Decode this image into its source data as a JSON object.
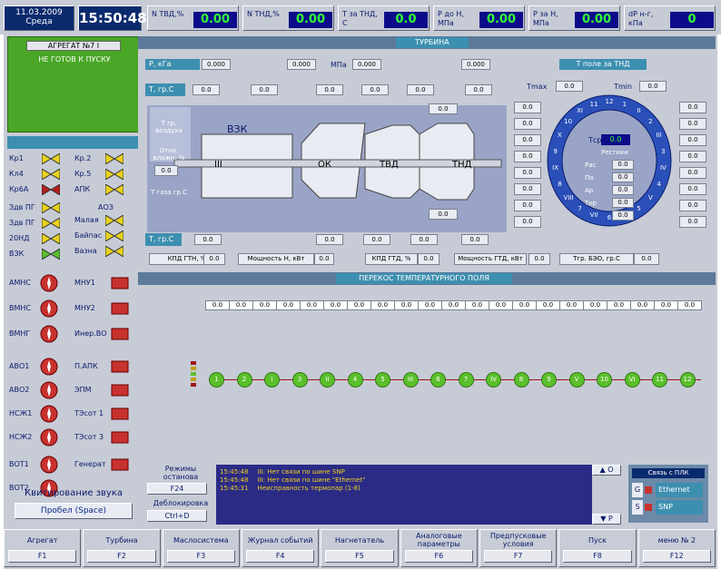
{
  "topbar": {
    "date": "11.03.2009",
    "day": "Среда",
    "time": "15:50:48",
    "params": [
      {
        "label": "N ТВД,%",
        "value": "0.00"
      },
      {
        "label": "N ТНД,%",
        "value": "0.00"
      },
      {
        "label": "T за ТНД, С",
        "value": "0.0"
      },
      {
        "label": "P до Н, МПа",
        "value": "0.00"
      },
      {
        "label": "P за Н, МПа",
        "value": "0.00"
      },
      {
        "label": "dP н-г, кПа",
        "value": "0"
      }
    ]
  },
  "status": {
    "aggregate": "АГРЕГАТ №7 I",
    "state": "НЕ ГОТОВ К ПУСКУ"
  },
  "valves_left": [
    {
      "label": "Кр1",
      "state": "yellow"
    },
    {
      "label": "Кл4",
      "state": "yellow"
    },
    {
      "label": "Кр6А",
      "state": "red"
    },
    {
      "label": "Здв ПГ",
      "state": "yellow"
    },
    {
      "label": "Здв ПГ",
      "state": "yellow"
    },
    {
      "label": "20НД",
      "state": "yellow"
    },
    {
      "label": "ВЗК",
      "state": "green"
    }
  ],
  "valves_right": [
    {
      "label": "Кр.2",
      "state": "yellow"
    },
    {
      "label": "Кр.5",
      "state": "yellow"
    },
    {
      "label": "АПК",
      "state": "yellow"
    },
    {
      "label": "Малая",
      "state": "yellow"
    },
    {
      "label": "Байпас",
      "state": "yellow"
    },
    {
      "label": "Вазна",
      "state": "yellow"
    }
  ],
  "aso_label": "АОЗ",
  "pumps_left": [
    "АМНС",
    "ВМНС",
    "ВМНГ",
    "АВО1",
    "АВО2",
    "НСЖ1",
    "НСЖ2",
    "ВОТ1",
    "ВОТ2"
  ],
  "pumps_right": [
    "МНУ1",
    "МНУ2",
    "Инер.ВО",
    "П.АПК",
    "ЭПМ",
    "ТЭсот 1",
    "ТЭсот 3",
    "Генерат"
  ],
  "sound": {
    "title": "Квитирование звука",
    "button": "Пробел (Space)"
  },
  "turbine": {
    "title": "ТУРБИНА",
    "p_label": "P, кГа",
    "p_values": [
      "0.000",
      "0.000",
      "0.000",
      "0.000"
    ],
    "p_unit": "МПа",
    "t_label": "T, гр.С",
    "t_values": [
      "0.0",
      "0.0",
      "0.0",
      "0.0",
      "0.0",
      "0.0"
    ],
    "t_lower_label": "T, гр.С",
    "t_lower_values": [
      "0.0",
      "0.0",
      "0.0",
      "0.0",
      "0.0"
    ],
    "t_air": "T гр. воздуха",
    "rel_hum": "Отно. влажн. %",
    "rel_val": "0.0",
    "t_fuel": "T газа гр.С",
    "vzk": "ВЗК",
    "blocks": [
      "III",
      "ОК",
      "ТВД",
      "ТНД"
    ],
    "mid_values": [
      "0.0",
      "0.0"
    ],
    "kpd_gtn": "КПД ГТН, %",
    "kpd_gtn_val": "0.0",
    "power_n": "Мощность Н, кВт",
    "power_n_val": "0.0",
    "kpd_gtd": "КПД ГТД, %",
    "kpd_gtd_val": "0.0",
    "power_gtd": "Мощность ГТД, кВт",
    "power_gtd_val": "0.0",
    "t_beo": "Тгр. БЭО, гр.С",
    "t_beo_val": "0.0"
  },
  "tnd_field": {
    "title": "T поле за ТНД",
    "tmax_label": "Tmax",
    "tmax": "0.0",
    "tmin_label": "Tmin",
    "tmin": "0.0",
    "left_values": [
      "0.0",
      "0.0",
      "0.0",
      "0.0",
      "0.0",
      "0.0",
      "0.0",
      "0.0"
    ],
    "right_values": [
      "0.0",
      "0.0",
      "0.0",
      "0.0",
      "0.0",
      "0.0",
      "0.0",
      "0.0"
    ],
    "center_label": "Тср",
    "center_val": "0.0",
    "sub_label": "Рестики",
    "center_small": [
      "0.0",
      "0.0",
      "0.0",
      "0.0",
      "0.0"
    ],
    "ring_labels": [
      "Рас",
      "По",
      "Ар",
      "Тор"
    ],
    "clock": [
      "12",
      "1",
      "II",
      "2",
      "III",
      "3",
      "IV",
      "4",
      "V",
      "5",
      "VI",
      "6",
      "VII",
      "7",
      "VIII",
      "8",
      "IX",
      "9",
      "X",
      "10",
      "XI",
      "11"
    ]
  },
  "temp_skew": {
    "title": "ПЕРЕКОС ТЕМПЕРАТУРНОГО ПОЛЯ",
    "values": [
      "0.0",
      "0.0",
      "0.0",
      "0.0",
      "0.0",
      "0.0",
      "0.0",
      "0.0",
      "0.0",
      "0.0",
      "0.0",
      "0.0",
      "0.0",
      "0.0",
      "0.0",
      "0.0",
      "0.0",
      "0.0",
      "0.0",
      "0.0",
      "0.0"
    ],
    "nodes": [
      "1",
      "2",
      "I",
      "3",
      "II",
      "4",
      "5",
      "III",
      "6",
      "7",
      "IV",
      "8",
      "9",
      "V",
      "10",
      "VI",
      "11",
      "12"
    ]
  },
  "bottom": {
    "modes_title": "Режимы останова",
    "modes_key": "F24",
    "block_title": "Деблокировка",
    "block_key": "Ctrl+D",
    "events": [
      {
        "time": "15:45:48",
        "text": "III: Нет связи по шине SNP"
      },
      {
        "time": "15:45:48",
        "text": "III: Нет связи по шине \"Ethernet\""
      },
      {
        "time": "15:45:31",
        "text": "Неисправность термопар (1-8)"
      }
    ],
    "scroll_up": "▲ О",
    "scroll_down": "▼ Р",
    "plc_title": "Связь с ПЛК",
    "links": [
      {
        "key": "G",
        "label": "Ethernet"
      },
      {
        "key": "S",
        "label": "SNP"
      }
    ]
  },
  "fkeys": [
    {
      "title": "Агрегат",
      "key": "F1"
    },
    {
      "title": "Турбина",
      "key": "F2"
    },
    {
      "title": "Маслосистема",
      "key": "F3"
    },
    {
      "title": "Журнал событий",
      "key": "F4"
    },
    {
      "title": "Нагнетатель",
      "key": "F5"
    },
    {
      "title": "Аналоговые параметры",
      "key": "F6"
    },
    {
      "title": "Предпусковые условия",
      "key": "F7"
    },
    {
      "title": "Пуск",
      "key": "F8"
    },
    {
      "title": "меню № 2",
      "key": "F12"
    }
  ],
  "colors": {
    "navy": "#0a2a6e",
    "green_status": "#49a626",
    "panel": "#c7cbd6",
    "turbine_bg": "#9aa4c6"
  }
}
